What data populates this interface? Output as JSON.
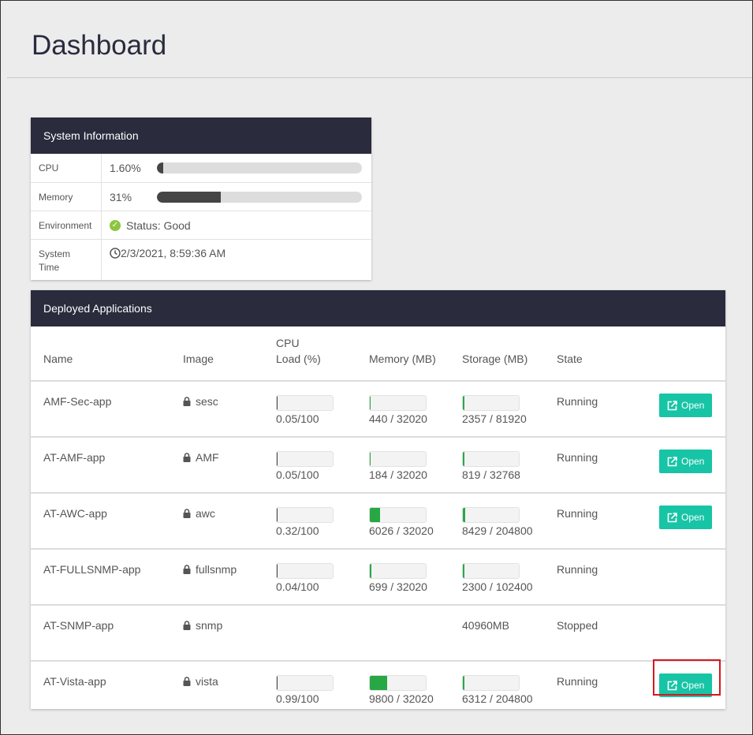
{
  "page": {
    "title": "Dashboard"
  },
  "system": {
    "title": "System Information",
    "cpu": {
      "label": "CPU",
      "value": "1.60%",
      "percent": 1.6
    },
    "memory": {
      "label": "Memory",
      "value": "31%",
      "percent": 31
    },
    "environment": {
      "label": "Environment",
      "value": "Status: Good"
    },
    "time": {
      "label": "System Time",
      "value": "2/3/2021, 8:59:36 AM"
    }
  },
  "apps": {
    "title": "Deployed Applications",
    "headers": {
      "name": "Name",
      "image": "Image",
      "cpu": "CPU Load (%)",
      "memory": "Memory (MB)",
      "storage": "Storage (MB)",
      "state": "State"
    },
    "open_label": "Open",
    "colors": {
      "memory_fill": "#28a745",
      "storage_fill": "#28a745",
      "cpu_fill": "#454545",
      "button": "#17c4a6"
    },
    "rows": [
      {
        "name": "AMF-Sec-app",
        "image": "sesc",
        "cpu": "0.05/100",
        "cpu_v": 0.05,
        "cpu_max": 100,
        "mem": "440 / 32020",
        "mem_v": 440,
        "mem_max": 32020,
        "sto": "2357 / 81920",
        "sto_v": 2357,
        "sto_max": 81920,
        "state": "Running",
        "open": true
      },
      {
        "name": "AT-AMF-app",
        "image": "AMF",
        "cpu": "0.05/100",
        "cpu_v": 0.05,
        "cpu_max": 100,
        "mem": "184 / 32020",
        "mem_v": 184,
        "mem_max": 32020,
        "sto": "819 / 32768",
        "sto_v": 819,
        "sto_max": 32768,
        "state": "Running",
        "open": true
      },
      {
        "name": "AT-AWC-app",
        "image": "awc",
        "cpu": "0.32/100",
        "cpu_v": 0.32,
        "cpu_max": 100,
        "mem": "6026 / 32020",
        "mem_v": 6026,
        "mem_max": 32020,
        "sto": "8429 / 204800",
        "sto_v": 8429,
        "sto_max": 204800,
        "state": "Running",
        "open": true
      },
      {
        "name": "AT-FULLSNMP-app",
        "image": "fullsnmp",
        "cpu": "0.04/100",
        "cpu_v": 0.04,
        "cpu_max": 100,
        "mem": "699 / 32020",
        "mem_v": 699,
        "mem_max": 32020,
        "sto": "2300 / 102400",
        "sto_v": 2300,
        "sto_max": 102400,
        "state": "Running",
        "open": false
      },
      {
        "name": "AT-SNMP-app",
        "image": "snmp",
        "cpu": null,
        "mem": null,
        "sto": "40960MB",
        "state": "Stopped",
        "open": false
      },
      {
        "name": "AT-Vista-app",
        "image": "vista",
        "cpu": "0.99/100",
        "cpu_v": 0.99,
        "cpu_max": 100,
        "mem": "9800 / 32020",
        "mem_v": 9800,
        "mem_max": 32020,
        "sto": "6312 / 204800",
        "sto_v": 6312,
        "sto_max": 204800,
        "state": "Running",
        "open": true
      }
    ]
  }
}
